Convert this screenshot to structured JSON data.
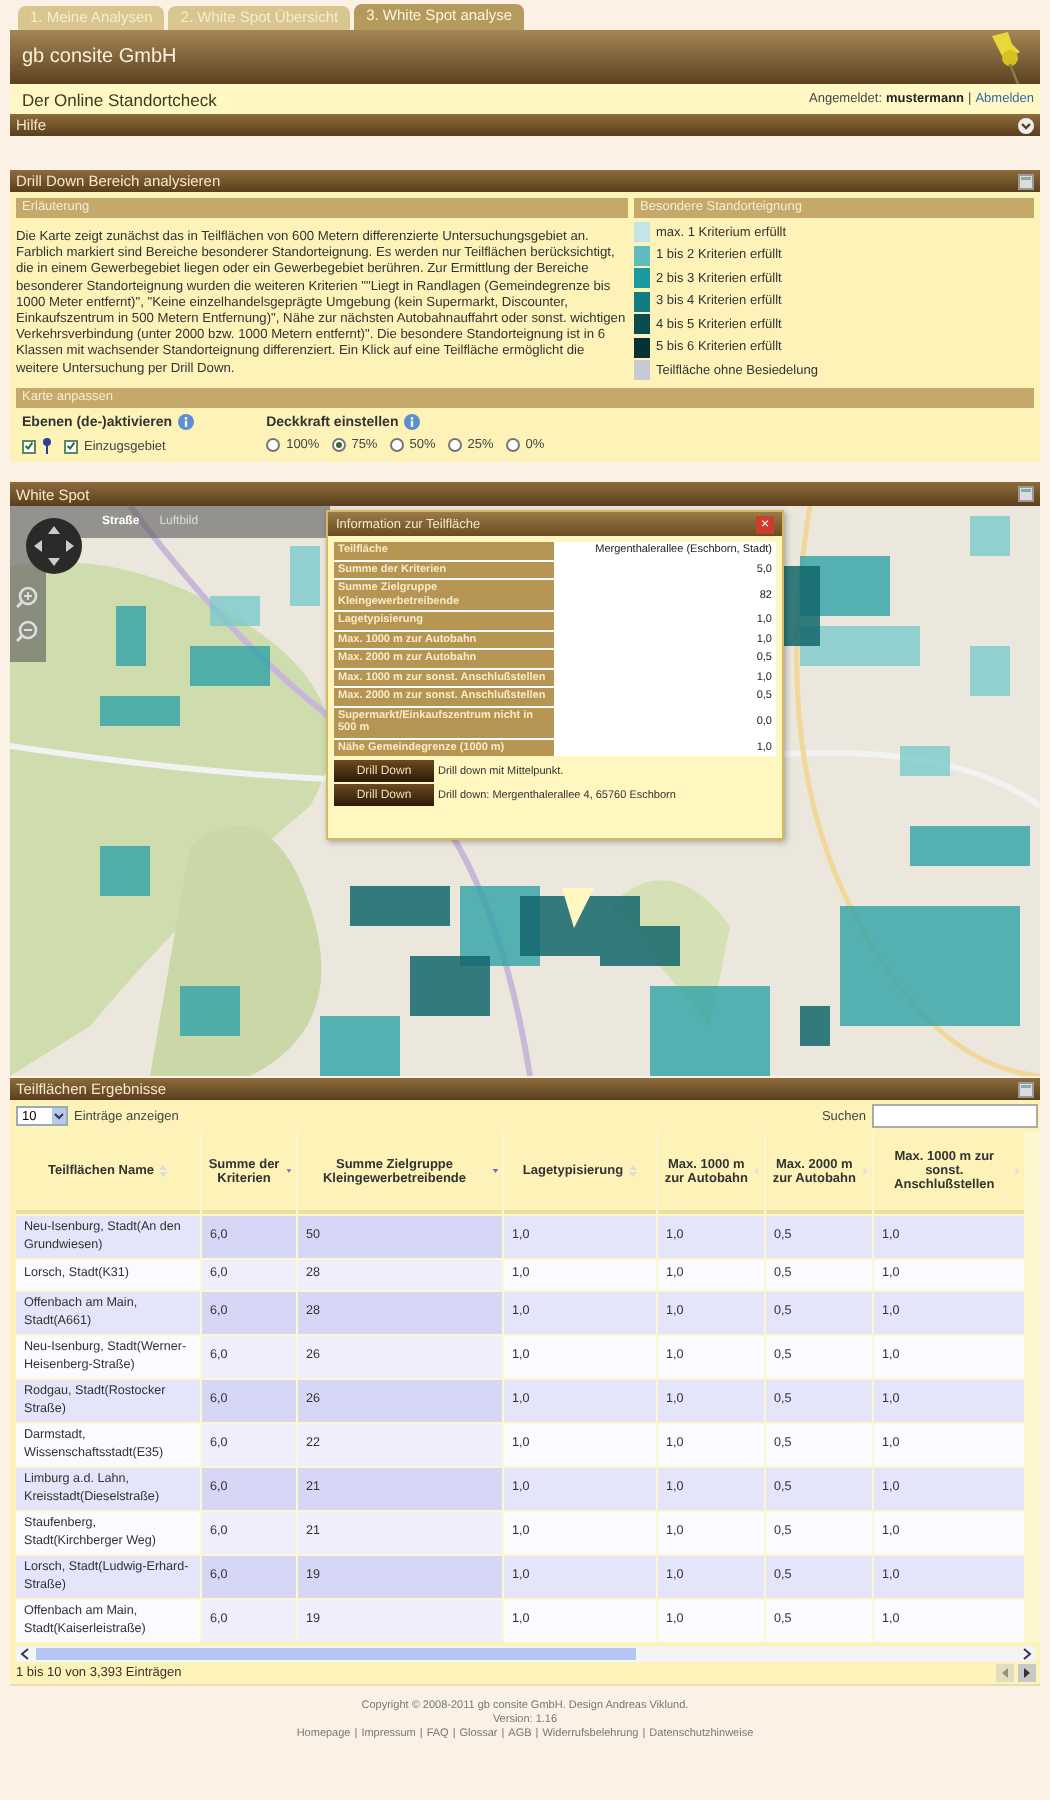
{
  "tabs": [
    {
      "label": "1. Meine Analysen",
      "selected": false
    },
    {
      "label": "2. White Spot Übersicht",
      "selected": false
    },
    {
      "label": "3. White Spot analyse",
      "selected": true
    }
  ],
  "header": {
    "company": "gb consite GmbH",
    "subtitle": "Der Online Standortcheck",
    "login_label": "Angemeldet:",
    "user": "mustermann",
    "separator": "|",
    "logout": "Abmelden"
  },
  "help_bar": {
    "title": "Hilfe",
    "expanded": false
  },
  "drilldown": {
    "title": "Drill Down Bereich analysieren",
    "explanation_title": "Erläuterung",
    "explanation": "Die Karte zeigt zunächst das in Teilflächen von 600 Metern differenzierte Untersuchungsgebiet an. Farblich markiert sind Bereiche besonderer Standorteignung. Es werden nur Teilflächen berücksichtigt, die in einem Gewerbegebiet liegen oder ein Gewerbegebiet berühren. Zur Ermittlung der Bereiche besonderer Standorteignung wurden die weiteren Kriterien \"\"Liegt in Randlagen (Gemeindegrenze bis 1000 Meter entfernt)\", \"Keine einzelhandelsgeprägte Umgebung (kein Supermarkt, Discounter, Einkaufszentrum in 500 Metern Entfernung)\", Nähe zur nächsten Autobahnauffahrt oder sonst. wichtigen Verkehrsverbindung (unter 2000 bzw. 1000 Metern entfernt)\". Die besondere Standorteignung ist in 6 Klassen mit wachsender Standorteignung differenziert. Ein Klick auf eine Teilfläche ermöglicht die weitere Untersuchung per Drill Down.",
    "legend_title": "Besondere Standorteignung",
    "legend": [
      {
        "label": "max. 1 Kriterium erfüllt",
        "color": "#c5e4e8"
      },
      {
        "label": "1 bis 2 Kriterien erfüllt",
        "color": "#5ebcc0"
      },
      {
        "label": "2 bis 3 Kriterien erfüllt",
        "color": "#1c9aa0"
      },
      {
        "label": "3 bis 4 Kriterien erfüllt",
        "color": "#137c82"
      },
      {
        "label": "4 bis 5 Kriterien erfüllt",
        "color": "#0a4d50"
      },
      {
        "label": "5 bis 6 Kriterien erfüllt",
        "color": "#063236"
      },
      {
        "label": "Teilfläche ohne Besiedelung",
        "color": "#c9c9d6"
      }
    ],
    "map_settings_title": "Karte anpassen",
    "layers_title": "Ebenen (de-)aktivieren",
    "layers": [
      {
        "kind": "marker",
        "checked": true
      },
      {
        "kind": "area",
        "label": "Einzugsgebiet",
        "checked": true
      }
    ],
    "opacity_title": "Deckkraft einstellen",
    "opacity": [
      {
        "label": "100%",
        "selected": false
      },
      {
        "label": "75%",
        "selected": true
      },
      {
        "label": "50%",
        "selected": false
      },
      {
        "label": "25%",
        "selected": false
      },
      {
        "label": "0%",
        "selected": false
      }
    ]
  },
  "map_panel": {
    "title": "White Spot",
    "modes": [
      {
        "label": "Straße",
        "selected": true
      },
      {
        "label": "Luftbild",
        "selected": false
      }
    ],
    "popup": {
      "title": "Information zur Teilfläche",
      "close": "×",
      "rows": [
        {
          "label": "Teilfläche",
          "value": "Mergenthalerallee (Eschborn, Stadt)"
        },
        {
          "label": "Summe der Kriterien",
          "value": "5,0"
        },
        {
          "label": "Summe Zielgruppe Kleingewerbetreibende",
          "value": "82"
        },
        {
          "label": "Lagetypisierung",
          "value": "1,0"
        },
        {
          "label": "Max. 1000 m zur Autobahn",
          "value": "1,0"
        },
        {
          "label": "Max. 2000 m zur Autobahn",
          "value": "0,5"
        },
        {
          "label": "Max. 1000 m zur sonst. Anschlußstellen",
          "value": "1,0"
        },
        {
          "label": "Max. 2000 m zur sonst. Anschlußstellen",
          "value": "0,5"
        },
        {
          "label": "Supermarkt/Einkaufszentrum nicht in 500 m",
          "value": "0,0"
        },
        {
          "label": "Nähe Gemeindegrenze (1000 m)",
          "value": "1,0"
        }
      ],
      "actions": [
        {
          "button": "Drill Down",
          "text": "Drill down mit Mittelpunkt."
        },
        {
          "button": "Drill Down",
          "text": "Drill down: Mergenthalerallee 4, 65760 Eschborn"
        }
      ]
    }
  },
  "results": {
    "title": "Teilflächen Ergebnisse",
    "page_size": "10",
    "page_size_label": "Einträge anzeigen",
    "search_label": "Suchen",
    "columns": [
      {
        "label": "Teilflächen Name",
        "sorted": false
      },
      {
        "label": "Summe der Kriterien",
        "sorted": true
      },
      {
        "label": "Summe Zielgruppe Kleingewerbetreibende",
        "sorted": true
      },
      {
        "label": "Lagetypisierung",
        "sorted": false
      },
      {
        "label": "Max. 1000 m zur Autobahn",
        "sorted": false
      },
      {
        "label": "Max. 2000 m zur Autobahn",
        "sorted": false
      },
      {
        "label": "Max. 1000 m zur sonst. Anschlußstellen",
        "sorted": false
      }
    ],
    "rows": [
      [
        "Neu-Isenburg, Stadt(An den Grundwiesen)",
        "6,0",
        "50",
        "1,0",
        "1,0",
        "0,5",
        "1,0"
      ],
      [
        "Lorsch, Stadt(K31)",
        "6,0",
        "28",
        "1,0",
        "1,0",
        "0,5",
        "1,0"
      ],
      [
        "Offenbach am Main, Stadt(A661)",
        "6,0",
        "28",
        "1,0",
        "1,0",
        "0,5",
        "1,0"
      ],
      [
        "Neu-Isenburg, Stadt(Werner-Heisenberg-Straße)",
        "6,0",
        "26",
        "1,0",
        "1,0",
        "0,5",
        "1,0"
      ],
      [
        "Rodgau, Stadt(Rostocker Straße)",
        "6,0",
        "26",
        "1,0",
        "1,0",
        "0,5",
        "1,0"
      ],
      [
        "Darmstadt, Wissenschaftsstadt(E35)",
        "6,0",
        "22",
        "1,0",
        "1,0",
        "0,5",
        "1,0"
      ],
      [
        "Limburg a.d. Lahn, Kreisstadt(Dieselstraße)",
        "6,0",
        "21",
        "1,0",
        "1,0",
        "0,5",
        "1,0"
      ],
      [
        "Staufenberg, Stadt(Kirchberger Weg)",
        "6,0",
        "21",
        "1,0",
        "1,0",
        "0,5",
        "1,0"
      ],
      [
        "Lorsch, Stadt(Ludwig-Erhard-Straße)",
        "6,0",
        "19",
        "1,0",
        "1,0",
        "0,5",
        "1,0"
      ],
      [
        "Offenbach am Main, Stadt(Kaiserleistraße)",
        "6,0",
        "19",
        "1,0",
        "1,0",
        "0,5",
        "1,0"
      ]
    ],
    "info": "1 bis 10 von 3,393 Einträgen",
    "pager": [
      {
        "kind": "previous",
        "disabled": true
      },
      {
        "kind": "next",
        "disabled": false
      }
    ]
  },
  "footer": {
    "copyright": "Copyright © 2008-2011 gb consite GmbH. Design Andreas Viklund.",
    "version": "Version: 1.16",
    "links": [
      "Homepage",
      "Impressum",
      "FAQ",
      "Glossar",
      "AGB",
      "Widerrufsbelehrung",
      "Datenschutzhinweise"
    ],
    "link_separator": "|"
  }
}
